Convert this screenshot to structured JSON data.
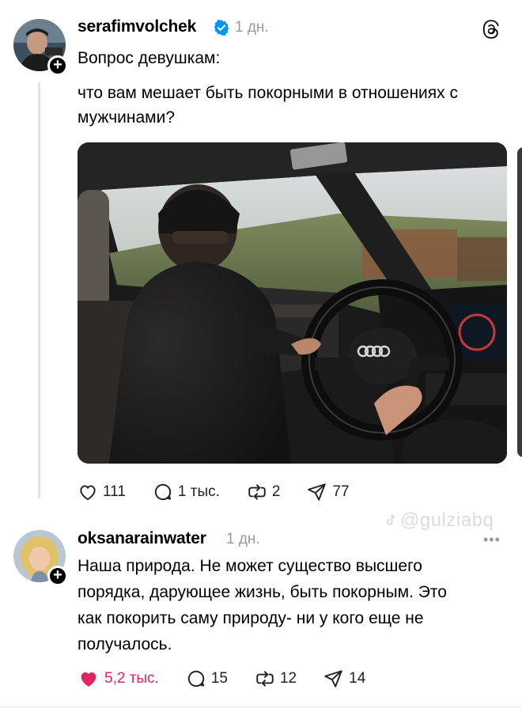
{
  "post": {
    "username": "serafimvolchek",
    "time": "1 дн.",
    "title_line": "Вопрос девушкам:",
    "body_line1": "что вам мешает быть покорными в отношениях с",
    "body_line2": "мужчинами?",
    "actions": {
      "likes": "111",
      "comments": "1 тыс.",
      "reposts": "2",
      "shares": "77"
    }
  },
  "watermark": "@gulziabq",
  "reply": {
    "username": "oksanarainwater",
    "time": "1 дн.",
    "lines": [
      "Наша природа. Не может существо высшего",
      "порядка, дарующее жизнь, быть покорным. Это",
      "как покорить саму природу- ни у кого еще не",
      "получалось."
    ],
    "actions": {
      "likes": "5,2 тыс.",
      "comments": "15",
      "reposts": "12",
      "shares": "14"
    }
  },
  "colors": {
    "verified": "#0095f6",
    "liked": "#e0245e",
    "muted": "#9a9a9a"
  },
  "icons": [
    "threads-logo-icon",
    "verified-icon",
    "heart-icon",
    "comment-icon",
    "repost-icon",
    "share-icon",
    "plus-icon",
    "more-icon"
  ]
}
